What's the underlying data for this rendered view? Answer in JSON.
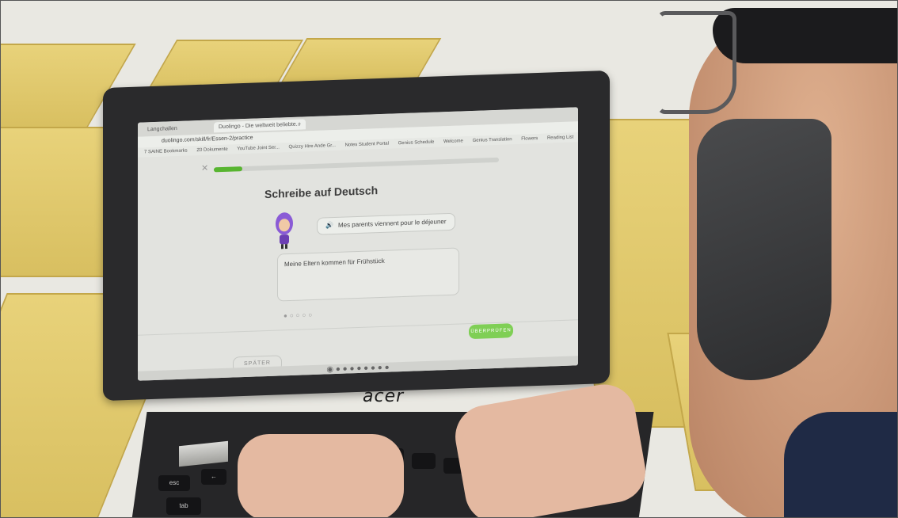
{
  "browser": {
    "tabs": [
      "Langchallen",
      "Duolingo - Die weltweit beliebte...",
      "+"
    ],
    "address": "duolingo.com/skill/fr/Essen-2/practice",
    "bookmarks": [
      "7 SAINE Bookmarks",
      "Z0 Dokumente",
      "YouTube Joint Ser...",
      "Quizzy Hire Ande Gr...",
      "Notes Student Portal",
      "Genius Schedule",
      "Welcome",
      "Genius Translation",
      "Flowers",
      "Reading List"
    ]
  },
  "lesson": {
    "progress_percent": 10,
    "close_label": "✕",
    "title": "Schreibe auf Deutsch",
    "prompt": "Mes parents viennent pour le déjeuner",
    "answer": "Meine Eltern kommen für Frühstück",
    "skip_label": "SPÄTER",
    "check_label": "ÜBERPRÜFEN"
  },
  "device": {
    "brand": "acer"
  },
  "colors": {
    "accent_green": "#58b530",
    "speaker_blue": "#1cb0f6",
    "table": "#e0c86c"
  }
}
